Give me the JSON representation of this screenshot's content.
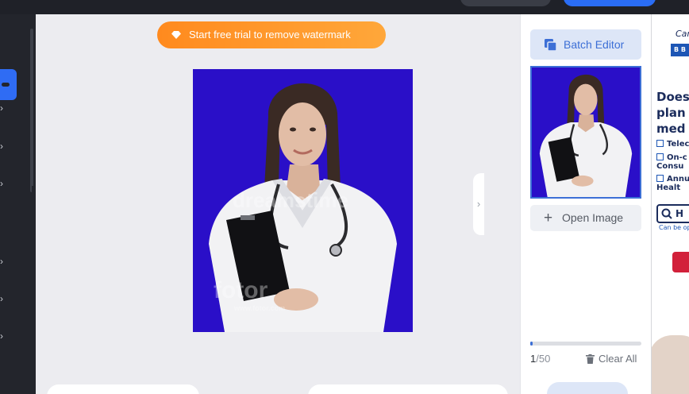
{
  "canvas": {
    "trial_label": "Start free trial to remove watermark",
    "watermark_top": "dreamstime",
    "watermark_brand": "fotor",
    "watermark_url": "www.fotor.com",
    "photo_bg": "#2a0fc8"
  },
  "right_panel": {
    "batch_label": "Batch Editor",
    "open_label": "Open Image",
    "count_current": "1",
    "count_total": "/50",
    "progress_fraction": 0.02,
    "clear_label": "Clear All"
  },
  "ad": {
    "brand": "Can",
    "headline": "Does\nplan\nmed",
    "bullets": [
      "Telec",
      "On-c\nConsu",
      "Annu\nHealt"
    ],
    "search_text": "H",
    "note": "Can be op"
  },
  "colors": {
    "accent": "#3c6fd6",
    "trial_orange": "#ff8a1e",
    "sidebar": "#23252c"
  }
}
